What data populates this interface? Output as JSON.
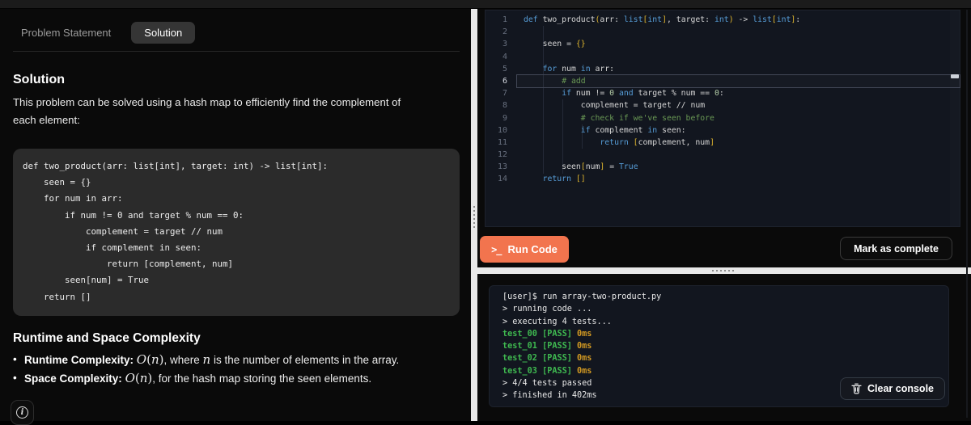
{
  "left_panel": {
    "tabs": [
      {
        "label": "Problem Statement",
        "active": false
      },
      {
        "label": "Solution",
        "active": true
      }
    ],
    "solution": {
      "heading": "Solution",
      "description": "This problem can be solved using a hash map to efficiently find the complement of each element:",
      "code_lines": [
        "def two_product(arr: list[int], target: int) -> list[int]:",
        "    seen = {}",
        "    for num in arr:",
        "        if num != 0 and target % num == 0:",
        "            complement = target // num",
        "            if complement in seen:",
        "                return [complement, num]",
        "        seen[num] = True",
        "    return []"
      ]
    },
    "complexity": {
      "heading": "Runtime and Space Complexity",
      "bullets": [
        {
          "parts": [
            {
              "t": "Runtime Complexity:",
              "s": "b"
            },
            {
              "t": " ",
              "s": "p"
            },
            {
              "t": "O",
              "s": "mi"
            },
            {
              "t": "(",
              "s": "mr"
            },
            {
              "t": "n",
              "s": "mi"
            },
            {
              "t": ")",
              "s": "mr"
            },
            {
              "t": ", where ",
              "s": "p"
            },
            {
              "t": "n",
              "s": "mi"
            },
            {
              "t": " is the number of elements in the array.",
              "s": "p"
            }
          ]
        },
        {
          "parts": [
            {
              "t": "Space Complexity:",
              "s": "b"
            },
            {
              "t": " ",
              "s": "p"
            },
            {
              "t": "O",
              "s": "mi"
            },
            {
              "t": "(",
              "s": "mr"
            },
            {
              "t": "n",
              "s": "mi"
            },
            {
              "t": ")",
              "s": "mr"
            },
            {
              "t": ", for the hash map storing the seen elements.",
              "s": "p"
            }
          ]
        }
      ]
    },
    "info_button_glyph": "i"
  },
  "editor": {
    "active_line": 6,
    "lines": [
      {
        "n": 1,
        "tokens": [
          [
            "def ",
            "kw"
          ],
          [
            "two_product",
            "pl"
          ],
          [
            "(",
            "br"
          ],
          [
            "arr: ",
            "pl"
          ],
          [
            "list",
            "kw"
          ],
          [
            "[",
            "br"
          ],
          [
            "int",
            "kw"
          ],
          [
            "]",
            "br"
          ],
          [
            ", target: ",
            "pl"
          ],
          [
            "int",
            "kw"
          ],
          [
            ")",
            "br"
          ],
          [
            " -> ",
            "pl"
          ],
          [
            "list",
            "kw"
          ],
          [
            "[",
            "br"
          ],
          [
            "int",
            "kw"
          ],
          [
            "]",
            "br"
          ],
          [
            ":",
            "pl"
          ]
        ]
      },
      {
        "n": 2,
        "tokens": []
      },
      {
        "n": 3,
        "tokens": [
          [
            "    seen = ",
            "pl"
          ],
          [
            "{}",
            "br"
          ]
        ]
      },
      {
        "n": 4,
        "tokens": []
      },
      {
        "n": 5,
        "tokens": [
          [
            "    ",
            "pl"
          ],
          [
            "for",
            "kw"
          ],
          [
            " num ",
            "pl"
          ],
          [
            "in",
            "kw"
          ],
          [
            " arr:",
            "pl"
          ]
        ]
      },
      {
        "n": 6,
        "tokens": [
          [
            "        ",
            "pl"
          ],
          [
            "# add",
            "cm"
          ]
        ]
      },
      {
        "n": 7,
        "tokens": [
          [
            "        ",
            "pl"
          ],
          [
            "if",
            "kw"
          ],
          [
            " num != ",
            "pl"
          ],
          [
            "0",
            "num"
          ],
          [
            " ",
            "pl"
          ],
          [
            "and",
            "kw"
          ],
          [
            " target % num == ",
            "pl"
          ],
          [
            "0",
            "num"
          ],
          [
            ":",
            "pl"
          ]
        ]
      },
      {
        "n": 8,
        "tokens": [
          [
            "            complement = target // num",
            "pl"
          ]
        ]
      },
      {
        "n": 9,
        "tokens": [
          [
            "            ",
            "pl"
          ],
          [
            "# check if we've seen before",
            "cm"
          ]
        ]
      },
      {
        "n": 10,
        "tokens": [
          [
            "            ",
            "pl"
          ],
          [
            "if",
            "kw"
          ],
          [
            " complement ",
            "pl"
          ],
          [
            "in",
            "kw"
          ],
          [
            " seen:",
            "pl"
          ]
        ]
      },
      {
        "n": 11,
        "tokens": [
          [
            "                ",
            "pl"
          ],
          [
            "return",
            "kw"
          ],
          [
            " ",
            "pl"
          ],
          [
            "[",
            "br"
          ],
          [
            "complement, num",
            "pl"
          ],
          [
            "]",
            "br"
          ]
        ]
      },
      {
        "n": 12,
        "tokens": []
      },
      {
        "n": 13,
        "tokens": [
          [
            "        seen",
            "pl"
          ],
          [
            "[",
            "br"
          ],
          [
            "num",
            "pl"
          ],
          [
            "]",
            "br"
          ],
          [
            " = ",
            "pl"
          ],
          [
            "True",
            "kw"
          ]
        ]
      },
      {
        "n": 14,
        "tokens": [
          [
            "    ",
            "pl"
          ],
          [
            "return",
            "kw"
          ],
          [
            " ",
            "pl"
          ],
          [
            "[]",
            "br"
          ]
        ]
      }
    ]
  },
  "actions": {
    "run_label": "Run Code",
    "run_icon_glyph": ">_",
    "mark_complete_label": "Mark as complete"
  },
  "console": {
    "lines": [
      {
        "tokens": [
          [
            "[user]$ run array-two-product.py",
            "pl"
          ]
        ]
      },
      {
        "tokens": [
          [
            "> running code ...",
            "pl"
          ]
        ]
      },
      {
        "tokens": [
          [
            "> executing 4 tests...",
            "pl"
          ]
        ]
      },
      {
        "tokens": [
          [
            "test_00 [PASS]",
            "ok"
          ],
          [
            " 0ms",
            "ms"
          ]
        ]
      },
      {
        "tokens": [
          [
            "test_01 [PASS]",
            "ok"
          ],
          [
            " 0ms",
            "ms"
          ]
        ]
      },
      {
        "tokens": [
          [
            "test_02 [PASS]",
            "ok"
          ],
          [
            " 0ms",
            "ms"
          ]
        ]
      },
      {
        "tokens": [
          [
            "test_03 [PASS]",
            "ok"
          ],
          [
            " 0ms",
            "ms"
          ]
        ]
      },
      {
        "tokens": [
          [
            "> 4/4 tests passed",
            "pl"
          ]
        ]
      },
      {
        "tokens": [
          [
            "> finished in 402ms",
            "pl"
          ]
        ]
      }
    ],
    "clear_label": "Clear console"
  },
  "colors": {
    "accent_orange": "#F2744E",
    "editor_background": "#12161f",
    "keyword_blue": "#569CD6",
    "comment_green": "#6A9955",
    "bracket_gold": "#DFB52E",
    "number_green": "#B5CEA8",
    "pass_green": "#3FB950",
    "time_orange": "#D29922",
    "splitter_gray": "#e8e8e8"
  }
}
